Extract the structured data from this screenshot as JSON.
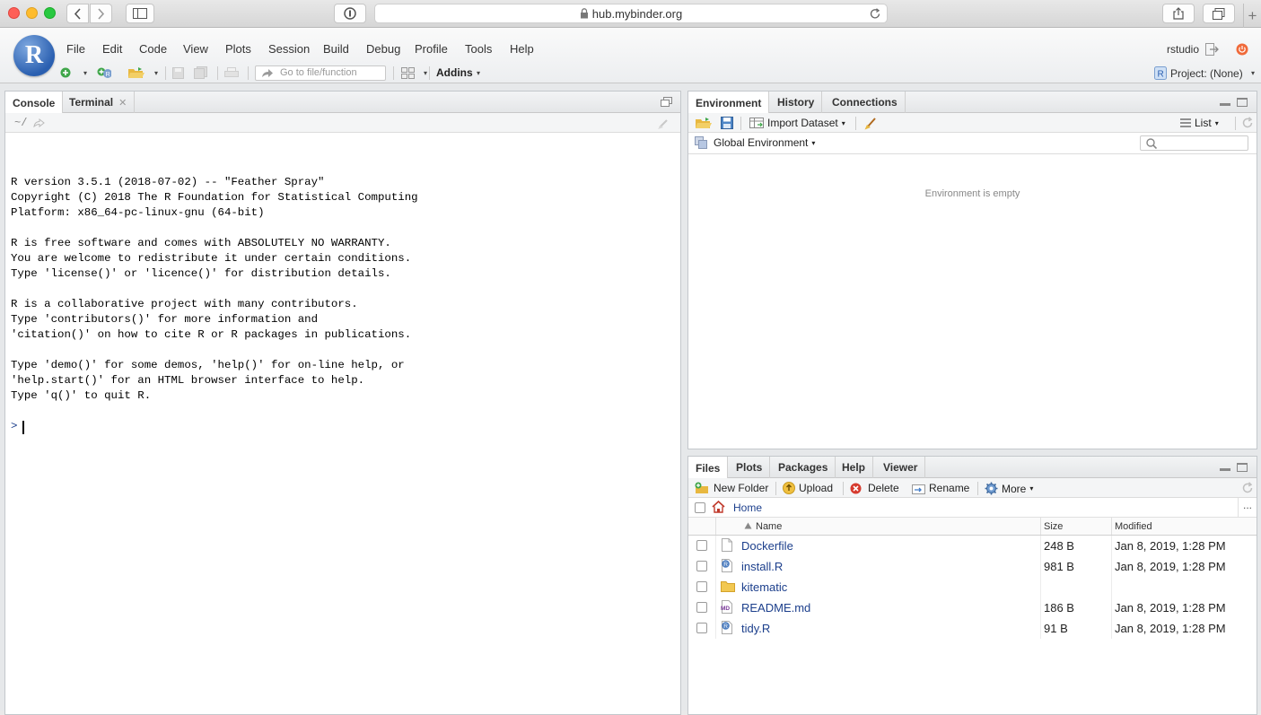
{
  "browser": {
    "url": "hub.mybinder.org",
    "colors": {
      "close": "#fe5f57",
      "minimize": "#febc2e",
      "zoom": "#28c840"
    }
  },
  "menubar": {
    "items": [
      "File",
      "Edit",
      "Code",
      "View",
      "Plots",
      "Session",
      "Build",
      "Debug",
      "Profile",
      "Tools",
      "Help"
    ],
    "user": "rstudio",
    "goto_placeholder": "Go to file/function",
    "addins": "Addins",
    "project": "Project: (None)",
    "logo_letter": "R"
  },
  "console": {
    "tabs": [
      "Console",
      "Terminal"
    ],
    "path": "~/",
    "lines": [
      "R version 3.5.1 (2018-07-02) -- \"Feather Spray\"",
      "Copyright (C) 2018 The R Foundation for Statistical Computing",
      "Platform: x86_64-pc-linux-gnu (64-bit)",
      "",
      "R is free software and comes with ABSOLUTELY NO WARRANTY.",
      "You are welcome to redistribute it under certain conditions.",
      "Type 'license()' or 'licence()' for distribution details.",
      "",
      "R is a collaborative project with many contributors.",
      "Type 'contributors()' for more information and",
      "'citation()' on how to cite R or R packages in publications.",
      "",
      "Type 'demo()' for some demos, 'help()' for on-line help, or",
      "'help.start()' for an HTML browser interface to help.",
      "Type 'q()' to quit R."
    ],
    "prompt": ">"
  },
  "environment": {
    "tabs": [
      "Environment",
      "History",
      "Connections"
    ],
    "import_dataset": "Import Dataset",
    "view_mode": "List",
    "scope": "Global Environment",
    "empty_message": "Environment is empty"
  },
  "files": {
    "tabs": [
      "Files",
      "Plots",
      "Packages",
      "Help",
      "Viewer"
    ],
    "toolbar": {
      "new_folder": "New Folder",
      "upload": "Upload",
      "delete": "Delete",
      "rename": "Rename",
      "more": "More"
    },
    "breadcrumb": "Home",
    "ellipsis": "...",
    "columns": {
      "name": "Name",
      "size": "Size",
      "modified": "Modified"
    },
    "rows": [
      {
        "name": "Dockerfile",
        "size": "248 B",
        "modified": "Jan 8, 2019, 1:28 PM",
        "icon": "file-icon"
      },
      {
        "name": "install.R",
        "size": "981 B",
        "modified": "Jan 8, 2019, 1:28 PM",
        "icon": "r-script-icon"
      },
      {
        "name": "kitematic",
        "size": "",
        "modified": "",
        "icon": "folder-icon"
      },
      {
        "name": "README.md",
        "size": "186 B",
        "modified": "Jan 8, 2019, 1:28 PM",
        "icon": "markdown-icon"
      },
      {
        "name": "tidy.R",
        "size": "91 B",
        "modified": "Jan 8, 2019, 1:28 PM",
        "icon": "r-script-icon"
      }
    ]
  }
}
